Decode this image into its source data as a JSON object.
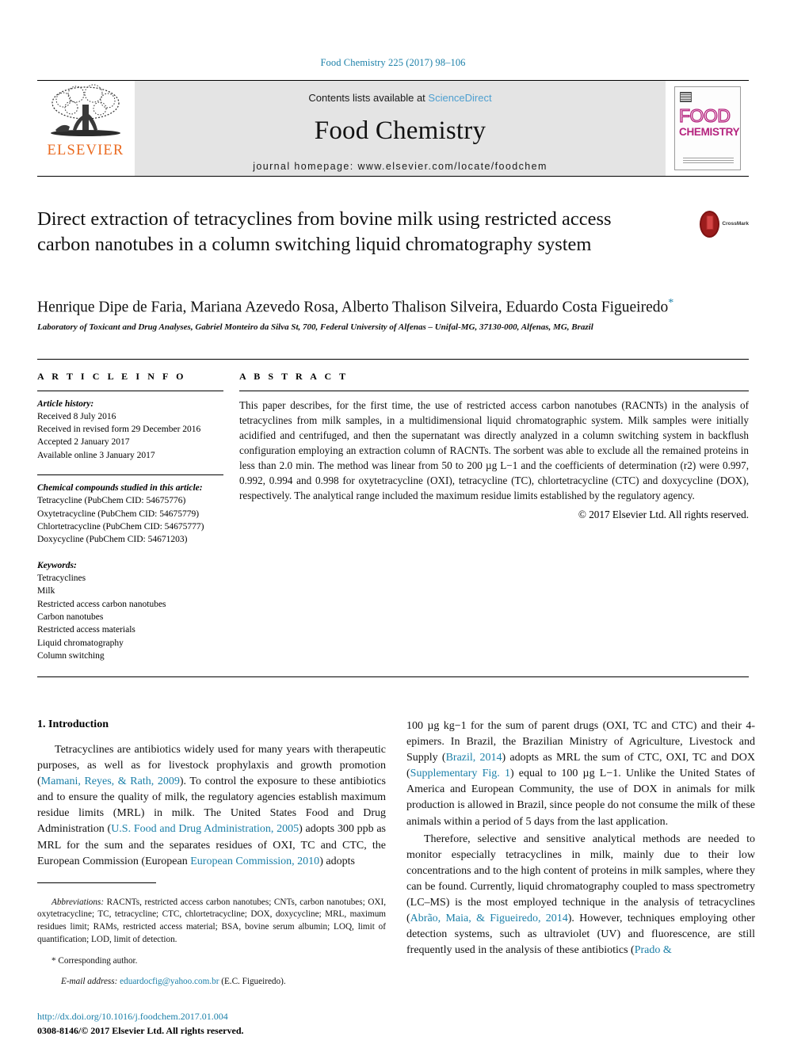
{
  "running_head": "Food Chemistry 225 (2017) 98–106",
  "masthead": {
    "publisher_name": "ELSEVIER",
    "contents_prefix": "Contents lists available at ",
    "contents_link": "ScienceDirect",
    "journal_title": "Food Chemistry",
    "homepage": "journal homepage: www.elsevier.com/locate/foodchem",
    "cover_word_top": "FOOD",
    "cover_word_bottom": "CHEMISTRY"
  },
  "article": {
    "title": "Direct extraction of tetracyclines from bovine milk using restricted access carbon nanotubes in a column switching liquid chromatography system",
    "crossmark_label": "CrossMark",
    "authors": "Henrique Dipe de Faria, Mariana Azevedo Rosa, Alberto Thalison Silveira, Eduardo Costa Figueiredo",
    "corresponding_marker": "*",
    "affiliation": "Laboratory of Toxicant and Drug Analyses, Gabriel Monteiro da Silva St, 700, Federal University of Alfenas – Unifal-MG, 37130-000, Alfenas, MG, Brazil"
  },
  "article_info": {
    "heading": "A R T I C L E    I N F O",
    "history_label": "Article history:",
    "history": [
      "Received 8 July 2016",
      "Received in revised form 29 December 2016",
      "Accepted 2 January 2017",
      "Available online 3 January 2017"
    ],
    "compounds_label": "Chemical compounds studied in this article:",
    "compounds": [
      "Tetracycline (PubChem CID: 54675776)",
      "Oxytetracycline (PubChem CID: 54675779)",
      "Chlortetracycline (PubChem CID: 54675777)",
      "Doxycycline (PubChem CID: 54671203)"
    ],
    "keywords_label": "Keywords:",
    "keywords": [
      "Tetracyclines",
      "Milk",
      "Restricted access carbon nanotubes",
      "Carbon nanotubes",
      "Restricted access materials",
      "Liquid chromatography",
      "Column switching"
    ]
  },
  "abstract": {
    "heading": "A B S T R A C T",
    "text": "This paper describes, for the first time, the use of restricted access carbon nanotubes (RACNTs) in the analysis of tetracyclines from milk samples, in a multidimensional liquid chromatographic system. Milk samples were initially acidified and centrifuged, and then the supernatant was directly analyzed in a column switching system in backflush configuration employing an extraction column of RACNTs. The sorbent was able to exclude all the remained proteins in less than 2.0 min. The method was linear from 50 to 200 µg L−1 and the coefficients of determination (r2) were 0.997, 0.992, 0.994 and 0.998 for oxytetracycline (OXI), tetracycline (TC), chlortetracycline (CTC) and doxycycline (DOX), respectively. The analytical range included the maximum residue limits established by the regulatory agency.",
    "copyright": "© 2017 Elsevier Ltd. All rights reserved."
  },
  "body": {
    "section_title": "1. Introduction",
    "left_paragraph_1": {
      "seg1": "Tetracyclines are antibiotics widely used for many years with therapeutic purposes, as well as for livestock prophylaxis and growth promotion (",
      "cite1": "Mamani, Reyes, & Rath, 2009",
      "seg2": "). To control the exposure to these antibiotics and to ensure the quality of milk, the regulatory agencies establish maximum residue limits (MRL) in milk. The United States Food and Drug Administration (",
      "cite2": "U.S. Food and Drug Administration, 2005",
      "seg3": ") adopts 300 ppb as MRL for the sum and the separates residues of OXI, TC and CTC, the European Commission (European ",
      "cite3": "European Commission, 2010",
      "seg4": ") adopts"
    },
    "right_paragraph_1": {
      "seg1": "100 µg kg−1 for the sum of parent drugs (OXI, TC and CTC) and their 4-epimers. In Brazil, the Brazilian Ministry of Agriculture, Livestock and Supply (",
      "cite1": "Brazil, 2014",
      "seg2": ") adopts as MRL the sum of CTC, OXI, TC and DOX (",
      "cite2": "Supplementary Fig. 1",
      "seg3": ") equal to 100 µg L−1. Unlike the United States of America and European Community, the use of DOX in animals for milk production is allowed in Brazil, since people do not consume the milk of these animals within a period of 5 days from the last application."
    },
    "right_paragraph_2": {
      "seg1": "Therefore, selective and sensitive analytical methods are needed to monitor especially tetracyclines in milk, mainly due to their low concentrations and to the high content of proteins in milk samples, where they can be found. Currently, liquid chromatography coupled to mass spectrometry (LC–MS) is the most employed technique in the analysis of tetracyclines (",
      "cite1": "Abrão, Maia, & Figueiredo, 2014",
      "seg2": "). However, techniques employing other detection systems, such as ultraviolet (UV) and fluorescence, are still frequently used in the analysis of these antibiotics (",
      "cite2": "Prado &"
    }
  },
  "footnotes": {
    "abbreviations_label": "Abbreviations:",
    "abbreviations_text": " RACNTs, restricted access carbon nanotubes; CNTs, carbon nanotubes; OXI, oxytetracycline; TC, tetracycline; CTC, chlortetracycline; DOX, doxycycline; MRL, maximum residues limit; RAMs, restricted access material; BSA, bovine serum albumin; LOQ, limit of quantification; LOD, limit of detection.",
    "corresponding_marker": "*",
    "corresponding_text": "Corresponding author.",
    "email_label": "E-mail address:",
    "email": "eduardocfig@yahoo.com.br",
    "email_suffix": " (E.C. Figueiredo)."
  },
  "footer": {
    "doi": "http://dx.doi.org/10.1016/j.foodchem.2017.01.004",
    "issn_copyright": "0308-8146/© 2017 Elsevier Ltd. All rights reserved."
  },
  "colors": {
    "link": "#1a7fa8",
    "elsevier_orange": "#ea6a20",
    "cover_magenta": "#b5237e",
    "banner_gray": "#e4e4e4",
    "crossmark_red": "#9b1c1c"
  }
}
